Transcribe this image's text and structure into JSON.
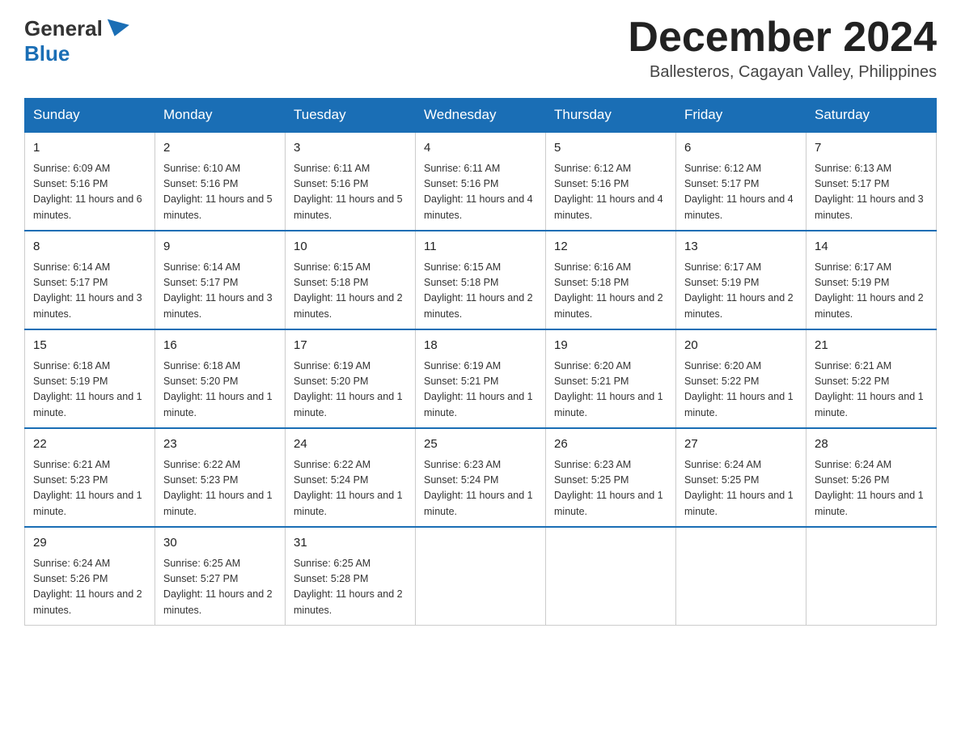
{
  "header": {
    "logo_general": "General",
    "logo_blue": "Blue",
    "month_title": "December 2024",
    "location": "Ballesteros, Cagayan Valley, Philippines"
  },
  "days_of_week": [
    "Sunday",
    "Monday",
    "Tuesday",
    "Wednesday",
    "Thursday",
    "Friday",
    "Saturday"
  ],
  "weeks": [
    [
      {
        "day": "1",
        "sunrise": "6:09 AM",
        "sunset": "5:16 PM",
        "daylight": "11 hours and 6 minutes."
      },
      {
        "day": "2",
        "sunrise": "6:10 AM",
        "sunset": "5:16 PM",
        "daylight": "11 hours and 5 minutes."
      },
      {
        "day": "3",
        "sunrise": "6:11 AM",
        "sunset": "5:16 PM",
        "daylight": "11 hours and 5 minutes."
      },
      {
        "day": "4",
        "sunrise": "6:11 AM",
        "sunset": "5:16 PM",
        "daylight": "11 hours and 4 minutes."
      },
      {
        "day": "5",
        "sunrise": "6:12 AM",
        "sunset": "5:16 PM",
        "daylight": "11 hours and 4 minutes."
      },
      {
        "day": "6",
        "sunrise": "6:12 AM",
        "sunset": "5:17 PM",
        "daylight": "11 hours and 4 minutes."
      },
      {
        "day": "7",
        "sunrise": "6:13 AM",
        "sunset": "5:17 PM",
        "daylight": "11 hours and 3 minutes."
      }
    ],
    [
      {
        "day": "8",
        "sunrise": "6:14 AM",
        "sunset": "5:17 PM",
        "daylight": "11 hours and 3 minutes."
      },
      {
        "day": "9",
        "sunrise": "6:14 AM",
        "sunset": "5:17 PM",
        "daylight": "11 hours and 3 minutes."
      },
      {
        "day": "10",
        "sunrise": "6:15 AM",
        "sunset": "5:18 PM",
        "daylight": "11 hours and 2 minutes."
      },
      {
        "day": "11",
        "sunrise": "6:15 AM",
        "sunset": "5:18 PM",
        "daylight": "11 hours and 2 minutes."
      },
      {
        "day": "12",
        "sunrise": "6:16 AM",
        "sunset": "5:18 PM",
        "daylight": "11 hours and 2 minutes."
      },
      {
        "day": "13",
        "sunrise": "6:17 AM",
        "sunset": "5:19 PM",
        "daylight": "11 hours and 2 minutes."
      },
      {
        "day": "14",
        "sunrise": "6:17 AM",
        "sunset": "5:19 PM",
        "daylight": "11 hours and 2 minutes."
      }
    ],
    [
      {
        "day": "15",
        "sunrise": "6:18 AM",
        "sunset": "5:19 PM",
        "daylight": "11 hours and 1 minute."
      },
      {
        "day": "16",
        "sunrise": "6:18 AM",
        "sunset": "5:20 PM",
        "daylight": "11 hours and 1 minute."
      },
      {
        "day": "17",
        "sunrise": "6:19 AM",
        "sunset": "5:20 PM",
        "daylight": "11 hours and 1 minute."
      },
      {
        "day": "18",
        "sunrise": "6:19 AM",
        "sunset": "5:21 PM",
        "daylight": "11 hours and 1 minute."
      },
      {
        "day": "19",
        "sunrise": "6:20 AM",
        "sunset": "5:21 PM",
        "daylight": "11 hours and 1 minute."
      },
      {
        "day": "20",
        "sunrise": "6:20 AM",
        "sunset": "5:22 PM",
        "daylight": "11 hours and 1 minute."
      },
      {
        "day": "21",
        "sunrise": "6:21 AM",
        "sunset": "5:22 PM",
        "daylight": "11 hours and 1 minute."
      }
    ],
    [
      {
        "day": "22",
        "sunrise": "6:21 AM",
        "sunset": "5:23 PM",
        "daylight": "11 hours and 1 minute."
      },
      {
        "day": "23",
        "sunrise": "6:22 AM",
        "sunset": "5:23 PM",
        "daylight": "11 hours and 1 minute."
      },
      {
        "day": "24",
        "sunrise": "6:22 AM",
        "sunset": "5:24 PM",
        "daylight": "11 hours and 1 minute."
      },
      {
        "day": "25",
        "sunrise": "6:23 AM",
        "sunset": "5:24 PM",
        "daylight": "11 hours and 1 minute."
      },
      {
        "day": "26",
        "sunrise": "6:23 AM",
        "sunset": "5:25 PM",
        "daylight": "11 hours and 1 minute."
      },
      {
        "day": "27",
        "sunrise": "6:24 AM",
        "sunset": "5:25 PM",
        "daylight": "11 hours and 1 minute."
      },
      {
        "day": "28",
        "sunrise": "6:24 AM",
        "sunset": "5:26 PM",
        "daylight": "11 hours and 1 minute."
      }
    ],
    [
      {
        "day": "29",
        "sunrise": "6:24 AM",
        "sunset": "5:26 PM",
        "daylight": "11 hours and 2 minutes."
      },
      {
        "day": "30",
        "sunrise": "6:25 AM",
        "sunset": "5:27 PM",
        "daylight": "11 hours and 2 minutes."
      },
      {
        "day": "31",
        "sunrise": "6:25 AM",
        "sunset": "5:28 PM",
        "daylight": "11 hours and 2 minutes."
      },
      null,
      null,
      null,
      null
    ]
  ]
}
